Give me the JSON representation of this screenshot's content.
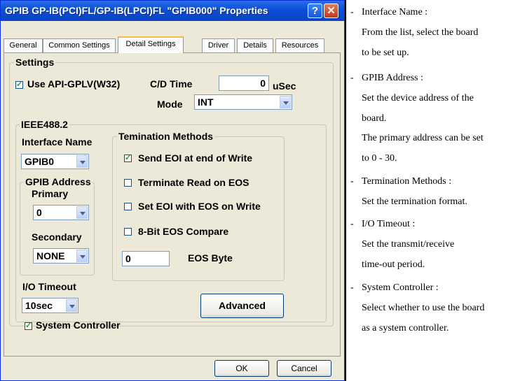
{
  "dialog": {
    "title": "GPIB GP-IB(PCI)FL/GP-IB(LPCI)FL \"GPIB000\" Properties",
    "help_label": "?",
    "close_label": "✕",
    "tabs": [
      {
        "label": "General"
      },
      {
        "label": "Common Settings"
      },
      {
        "label": "Detail Settings"
      },
      {
        "label": "Driver"
      },
      {
        "label": "Details"
      },
      {
        "label": "Resources"
      }
    ],
    "active_tab": "Detail Settings",
    "settings": {
      "group_label": "Settings",
      "use_api_label": "Use API-GPLV(W32)",
      "use_api_checked": true,
      "cd_time_label": "C/D Time",
      "cd_time_value": "0",
      "cd_time_unit": "uSec",
      "mode_label": "Mode",
      "mode_value": "INT"
    },
    "ieee": {
      "group_label": "IEEE488.2",
      "interface_name_label": "Interface Name",
      "interface_name_value": "GPIB0",
      "gpib_address_label": "GPIB Address",
      "primary_label": "Primary",
      "primary_value": "0",
      "secondary_label": "Secondary",
      "secondary_value": "NONE",
      "io_timeout_label": "I/O Timeout",
      "io_timeout_value": "10sec",
      "system_controller_label": "System Controller",
      "system_controller_checked": true
    },
    "termination": {
      "group_label": "Temination Methods",
      "options": [
        {
          "label": "Send EOI at end of Write",
          "checked": true
        },
        {
          "label": "Terminate Read on EOS",
          "checked": false
        },
        {
          "label": "Set EOI with EOS on Write",
          "checked": false
        },
        {
          "label": "8-Bit EOS Compare",
          "checked": false
        }
      ],
      "eos_byte_value": "0",
      "eos_byte_label": "EOS Byte"
    },
    "advanced_label": "Advanced",
    "ok_label": "OK",
    "cancel_label": "Cancel"
  },
  "help_panel": {
    "items": [
      {
        "lines": [
          "Interface Name :",
          "From the list, select the board",
          "to be  set up."
        ]
      },
      {
        "lines": [
          "GPIB Address :",
          "Set the device address of the",
          "board.",
          "The primary address can be set",
          "to 0  - 30."
        ]
      },
      {
        "lines": [
          "Termination Methods :",
          "Set the termination format."
        ]
      },
      {
        "lines": [
          "I/O Timeout :",
          "Set the transmit/receive",
          "time-out period."
        ]
      },
      {
        "lines": [
          "System Controller :",
          "Select whether to use the board",
          "as a  system controller."
        ]
      }
    ]
  },
  "colors": {
    "titlebar": "#0a4fd6",
    "dialog_bg": "#ece9d8",
    "check_mark": "#21a121",
    "active_tab_accent": "#f9b94d"
  }
}
